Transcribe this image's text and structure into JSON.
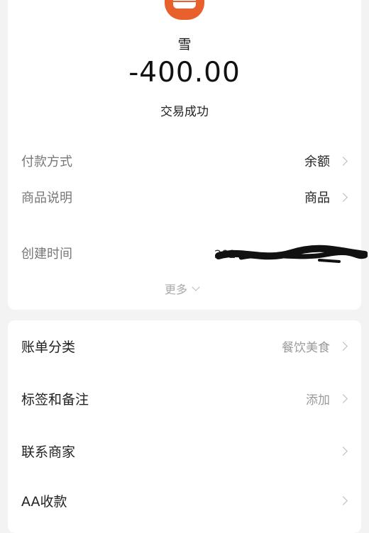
{
  "header": {
    "merchant_name": "雪",
    "amount": "-400.00",
    "status": "交易成功",
    "avatar_icon": "shop-icon",
    "avatar_color": "#e8612c"
  },
  "details": {
    "payment_method": {
      "label": "付款方式",
      "value": "余额"
    },
    "product_desc": {
      "label": "商品说明",
      "value": "商品"
    },
    "created_time": {
      "label": "创建时间",
      "value": "202"
    },
    "more_label": "更多"
  },
  "actions": {
    "category": {
      "label": "账单分类",
      "value": "餐饮美食"
    },
    "tags": {
      "label": "标签和备注",
      "value": "添加"
    },
    "contact": {
      "label": "联系商家"
    },
    "aa": {
      "label": "AA收款"
    }
  }
}
